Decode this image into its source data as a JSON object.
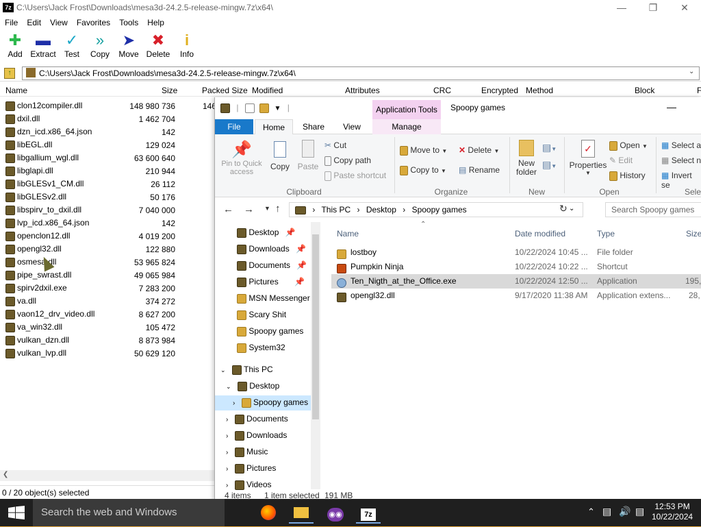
{
  "sevenzip": {
    "title": "C:\\Users\\Jack Frost\\Downloads\\mesa3d-24.2.5-release-mingw.7z\\x64\\",
    "app_icon": "7z",
    "menu": [
      "File",
      "Edit",
      "View",
      "Favorites",
      "Tools",
      "Help"
    ],
    "toolbar": [
      {
        "label": "Add",
        "icon": "plus-icon",
        "color": "#2db84d"
      },
      {
        "label": "Extract",
        "icon": "minus-icon",
        "color": "#1e2fa8"
      },
      {
        "label": "Test",
        "icon": "check-icon",
        "color": "#1aa8c8"
      },
      {
        "label": "Copy",
        "icon": "double-arrow-icon",
        "color": "#16a0a0"
      },
      {
        "label": "Move",
        "icon": "arrow-right-icon",
        "color": "#1e2fa8"
      },
      {
        "label": "Delete",
        "icon": "x-icon",
        "color": "#d8202a"
      },
      {
        "label": "Info",
        "icon": "info-icon",
        "color": "#e0b020"
      }
    ],
    "address": "C:\\Users\\Jack Frost\\Downloads\\mesa3d-24.2.5-release-mingw.7z\\x64\\",
    "columns": [
      "Name",
      "Size",
      "Packed Size",
      "Modified",
      "Attributes",
      "CRC",
      "Encrypted",
      "Method",
      "Block",
      "F"
    ],
    "packed_partial": "146",
    "files": [
      {
        "name": "clon12compiler.dll",
        "size": "148 980 736"
      },
      {
        "name": "dxil.dll",
        "size": "1 462 704"
      },
      {
        "name": "dzn_icd.x86_64.json",
        "size": "142"
      },
      {
        "name": "libEGL.dll",
        "size": "129 024"
      },
      {
        "name": "libgallium_wgl.dll",
        "size": "63 600 640"
      },
      {
        "name": "libglapi.dll",
        "size": "210 944"
      },
      {
        "name": "libGLESv1_CM.dll",
        "size": "26 112"
      },
      {
        "name": "libGLESv2.dll",
        "size": "50 176"
      },
      {
        "name": "libspirv_to_dxil.dll",
        "size": "7 040 000"
      },
      {
        "name": "lvp_icd.x86_64.json",
        "size": "142"
      },
      {
        "name": "openclon12.dll",
        "size": "4 019 200"
      },
      {
        "name": "opengl32.dll",
        "size": "122 880"
      },
      {
        "name": "osmesa.dll",
        "size": "53 965 824"
      },
      {
        "name": "pipe_swrast.dll",
        "size": "49 065 984"
      },
      {
        "name": "spirv2dxil.exe",
        "size": "7 283 200"
      },
      {
        "name": "va.dll",
        "size": "374 272"
      },
      {
        "name": "vaon12_drv_video.dll",
        "size": "8 627 200"
      },
      {
        "name": "va_win32.dll",
        "size": "105 472"
      },
      {
        "name": "vulkan_dzn.dll",
        "size": "8 873 984"
      },
      {
        "name": "vulkan_lvp.dll",
        "size": "50 629 120"
      }
    ],
    "status": "0 / 20 object(s) selected"
  },
  "explorer": {
    "app_tools": "Application Tools",
    "window_title": "Spoopy games",
    "tabs": {
      "file": "File",
      "home": "Home",
      "share": "Share",
      "view": "View",
      "manage": "Manage"
    },
    "ribbon": {
      "pin": "Pin to Quick access",
      "copy": "Copy",
      "paste": "Paste",
      "cut": "Cut",
      "copy_path": "Copy path",
      "paste_shortcut": "Paste shortcut",
      "move_to": "Move to",
      "copy_to": "Copy to",
      "delete": "Delete",
      "rename": "Rename",
      "new_folder": "New folder",
      "properties": "Properties",
      "open": "Open",
      "edit": "Edit",
      "history": "History",
      "select_all": "Select a",
      "select_none": "Select n",
      "invert": "Invert se",
      "groups": {
        "clipboard": "Clipboard",
        "organize": "Organize",
        "new": "New",
        "open": "Open",
        "select": "Selec"
      }
    },
    "breadcrumb": [
      "This PC",
      "Desktop",
      "Spoopy games"
    ],
    "search_placeholder": "Search Spoopy games",
    "tree": {
      "quick": [
        {
          "label": "Desktop",
          "pinned": true
        },
        {
          "label": "Downloads",
          "pinned": true
        },
        {
          "label": "Documents",
          "pinned": true
        },
        {
          "label": "Pictures",
          "pinned": true
        },
        {
          "label": "MSN Messenger",
          "pinned": false
        },
        {
          "label": "Scary Shit",
          "pinned": false
        },
        {
          "label": "Spoopy games",
          "pinned": false
        },
        {
          "label": "System32",
          "pinned": false
        }
      ],
      "this_pc": "This PC",
      "desktop": "Desktop",
      "spoopy": "Spoopy games",
      "pc_items": [
        "Documents",
        "Downloads",
        "Music",
        "Pictures",
        "Videos"
      ]
    },
    "columns": {
      "name": "Name",
      "date": "Date modified",
      "type": "Type",
      "size": "Size"
    },
    "files": [
      {
        "name": "lostboy",
        "date": "10/22/2024 10:45 ...",
        "type": "File folder",
        "size": "",
        "icon": "folder-icon"
      },
      {
        "name": "Pumpkin Ninja",
        "date": "10/22/2024 10:22 ...",
        "type": "Shortcut",
        "size": "",
        "icon": "shortcut-icon"
      },
      {
        "name": "Ten_Nigth_at_the_Office.exe",
        "date": "10/22/2024 12:50 ...",
        "type": "Application",
        "size": "195,",
        "icon": "exe-icon",
        "selected": true
      },
      {
        "name": "opengl32.dll",
        "date": "9/17/2020 11:38 AM",
        "type": "Application extens...",
        "size": "28,",
        "icon": "dll-icon"
      }
    ],
    "status": {
      "items": "4 items",
      "selected": "1 item selected",
      "size": "191 MB"
    }
  },
  "taskbar": {
    "search": "Search the web and Windows",
    "apps": [
      "firefox-icon",
      "file-explorer-icon",
      "game-app-icon",
      "7zip-icon"
    ],
    "time": "12:53 PM",
    "date": "10/22/2024"
  }
}
